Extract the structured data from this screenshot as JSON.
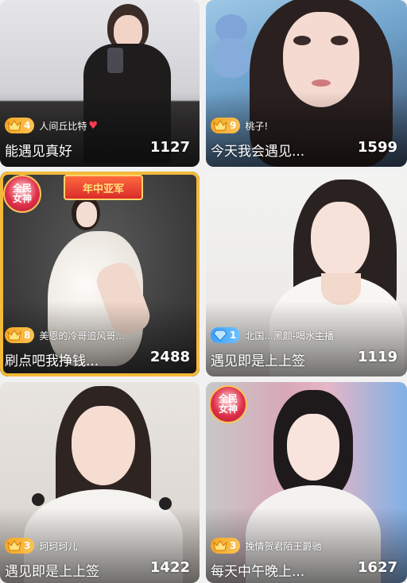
{
  "cards": [
    {
      "level": "4",
      "level_type": "crown",
      "user": "人间丘比特",
      "heart": "♥",
      "title": "能遇见真好",
      "viewers": "1127"
    },
    {
      "level": "9",
      "level_type": "crown",
      "user": "桃子!",
      "title": "今天我会遇见...",
      "viewers": "1599"
    },
    {
      "level": "8",
      "level_type": "crown",
      "user": "美恩的冷哥追风哥...",
      "title": "刷点吧我挣钱...",
      "viewers": "2488",
      "ribbon": [
        "全民",
        "女神"
      ],
      "banner": "年中亚军"
    },
    {
      "level": "1",
      "level_type": "diamond",
      "user": "北国...黑颜-喝水主播",
      "title": "遇见即是上上签",
      "viewers": "1119"
    },
    {
      "level": "3",
      "level_type": "crown",
      "user": "珂珂珂儿",
      "title": "遇见即是上上签",
      "viewers": "1422"
    },
    {
      "level": "3",
      "level_type": "crown",
      "user": "挽情贺君陌王爵驰",
      "title": "每天中午晚上...",
      "viewers": "1627",
      "ribbon": [
        "全民",
        "女神"
      ]
    }
  ],
  "colors": {
    "gold_badge": "#f6a623",
    "blue_badge": "#3aa0ff",
    "heart": "#ff3b4e",
    "frame": "#f3b93a"
  }
}
